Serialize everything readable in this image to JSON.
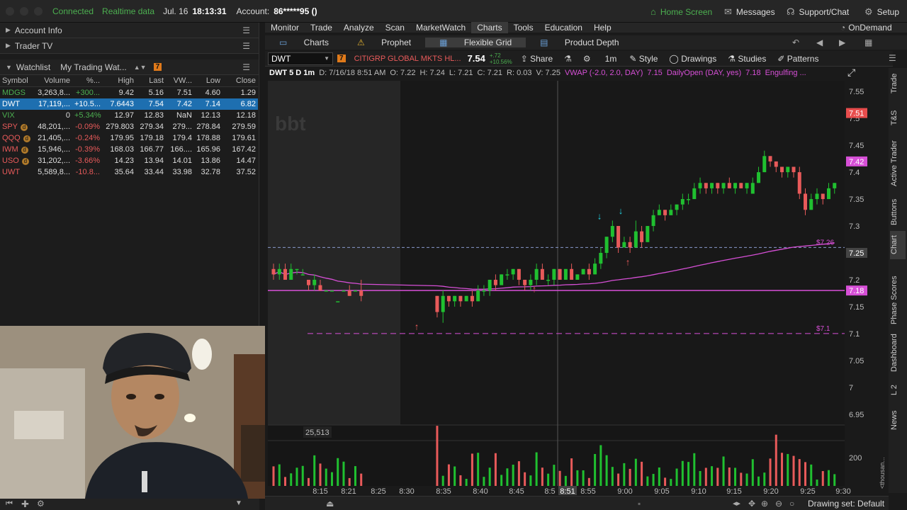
{
  "topbar": {
    "status": "Connected",
    "data_mode": "Realtime data",
    "date": "Jul. 16",
    "time": "18:13:31",
    "account_label": "Account:",
    "account_value": "86*****95 ()",
    "home_screen": "Home Screen",
    "messages": "Messages",
    "support": "Support/Chat",
    "setup": "Setup"
  },
  "left": {
    "account_info": "Account Info",
    "trader_tv": "Trader TV",
    "watchlist_label": "Watchlist",
    "watchlist_name": "My Trading Wat...",
    "watchlist_badge": "7",
    "columns": [
      "Symbol",
      "Volume",
      "%...",
      "High",
      "Last",
      "VW...",
      "Low",
      "Close"
    ],
    "rows": [
      {
        "symbol": "MDGS",
        "volume": "3,263,8...",
        "pct": "+300...",
        "high": "9.42",
        "last": "5.16",
        "vw": "7.51",
        "low": "4.60",
        "close": "1.29",
        "dir": "pos",
        "badge": ""
      },
      {
        "symbol": "DWT",
        "volume": "17,119,...",
        "pct": "+10.5...",
        "high": "7.6443",
        "last": "7.54",
        "vw": "7.42",
        "low": "7.14",
        "close": "6.82",
        "dir": "sel",
        "badge": ""
      },
      {
        "symbol": "VIX",
        "volume": "0",
        "pct": "+5.34%",
        "high": "12.97",
        "last": "12.83",
        "vw": "NaN",
        "low": "12.13",
        "close": "12.18",
        "dir": "pos",
        "badge": ""
      },
      {
        "symbol": "SPY",
        "volume": "48,201,...",
        "pct": "-0.09%",
        "high": "279.803",
        "last": "279.34",
        "vw": "279...",
        "low": "278.84",
        "close": "279.59",
        "dir": "neg",
        "badge": "d"
      },
      {
        "symbol": "QQQ",
        "volume": "21,405,...",
        "pct": "-0.24%",
        "high": "179.95",
        "last": "179.18",
        "vw": "179.4",
        "low": "178.88",
        "close": "179.61",
        "dir": "neg",
        "badge": "d"
      },
      {
        "symbol": "IWM",
        "volume": "15,946,...",
        "pct": "-0.39%",
        "high": "168.03",
        "last": "166.77",
        "vw": "166....",
        "low": "165.96",
        "close": "167.42",
        "dir": "neg",
        "badge": "d"
      },
      {
        "symbol": "USO",
        "volume": "31,202,...",
        "pct": "-3.66%",
        "high": "14.23",
        "last": "13.94",
        "vw": "14.01",
        "low": "13.86",
        "close": "14.47",
        "dir": "neg",
        "badge": "d"
      },
      {
        "symbol": "UWT",
        "volume": "5,589,8...",
        "pct": "-10.8...",
        "high": "35.64",
        "last": "33.44",
        "vw": "33.98",
        "low": "32.78",
        "close": "37.52",
        "dir": "neg",
        "badge": ""
      }
    ]
  },
  "menu": [
    "Monitor",
    "Trade",
    "Analyze",
    "Scan",
    "MarketWatch",
    "Charts",
    "Tools",
    "Education",
    "Help"
  ],
  "menu_active": "Charts",
  "ondemand": "OnDemand",
  "subtabs": [
    "Charts",
    "Prophet",
    "Flexible Grid",
    "Product Depth"
  ],
  "toolbar": {
    "symbol": "DWT",
    "badge": "7",
    "description": "CITIGRP GLOBAL MKTS HL...",
    "price": "7.54",
    "change_top": "+.72",
    "change_bottom": "+10.56%",
    "share": "Share",
    "interval": "1m",
    "style": "Style",
    "drawings": "Drawings",
    "studies": "Studies",
    "patterns": "Patterns"
  },
  "infobar": {
    "title": "DWT 5 D 1m",
    "d": "D: 7/16/18 8:51 AM",
    "o": "O: 7.22",
    "h": "H: 7.24",
    "l": "L: 7.21",
    "c": "C: 7.21",
    "r": "R: 0.03",
    "v": "V: 7.25",
    "vwap": "VWAP (-2.0, 2.0, DAY)",
    "vwap_val": "7.15",
    "daily": "DailyOpen (DAY, yes)",
    "daily_val": "7.18",
    "engulf": "Engulfing ..."
  },
  "chart_data": {
    "type": "candlestick",
    "price_axis_ticks": [
      "7.55",
      "7.5",
      "7.45",
      "7.4",
      "7.35",
      "7.3",
      "7.25",
      "7.2",
      "7.15",
      "7.1",
      "7.05",
      "7",
      "6.95"
    ],
    "ylim": [
      6.93,
      7.57
    ],
    "time_ticks": [
      "8:15",
      "8:21",
      "8:25",
      "8:30",
      "8:35",
      "8:40",
      "8:45",
      "8:5",
      "8:51",
      "8:55",
      "9:00",
      "9:05",
      "9:10",
      "9:15",
      "9:20",
      "9:25",
      "9:30"
    ],
    "price_labels": [
      {
        "value": 7.51,
        "text": "7.51",
        "color": "#e84d4d"
      },
      {
        "value": 7.42,
        "text": "7.42",
        "color": "#d64fd6"
      },
      {
        "value": 7.25,
        "text": "7.25",
        "color": "#444444"
      },
      {
        "value": 7.18,
        "text": "7.18",
        "color": "#d64fd6"
      }
    ],
    "line_labels": [
      {
        "value": 7.26,
        "text": "$7.26"
      },
      {
        "value": 7.1,
        "text": "$7.1"
      }
    ],
    "daily_open": 7.18,
    "dashed_support": 7.1,
    "dashed_level": 7.26,
    "volume_label": "25,513",
    "volume_axis": [
      "200"
    ],
    "volume_unit": "<thousan...",
    "candles": [
      [
        7.22,
        7.21,
        7.23,
        7.2
      ],
      [
        7.21,
        7.22,
        7.23,
        7.2
      ],
      [
        7.22,
        7.2,
        7.23,
        7.2
      ],
      [
        7.2,
        7.22,
        7.23,
        7.2
      ],
      [
        7.22,
        7.22,
        7.22,
        7.21
      ],
      [
        7.21,
        7.21,
        7.22,
        7.21
      ],
      [
        7.2,
        7.19,
        7.2,
        7.18
      ],
      [
        7.19,
        7.2,
        7.21,
        7.18
      ],
      [
        7.19,
        7.18,
        7.2,
        7.18
      ],
      [
        7.18,
        7.18,
        7.18,
        7.18
      ],
      [
        7.18,
        7.18,
        7.18,
        7.18
      ],
      [
        7.16,
        7.16,
        7.16,
        7.16
      ],
      [
        7.18,
        7.18,
        7.18,
        7.18
      ],
      [
        7.18,
        7.17,
        7.19,
        7.17
      ],
      [
        7.18,
        7.18,
        7.18,
        7.18
      ],
      [
        7.18,
        7.17,
        7.2,
        7.16
      ],
      [
        7.17,
        7.14,
        7.17,
        7.13
      ],
      [
        7.14,
        7.17,
        7.18,
        7.12
      ],
      [
        7.17,
        7.16,
        7.17,
        7.15
      ],
      [
        7.16,
        7.17,
        7.17,
        7.15
      ],
      [
        7.17,
        7.16,
        7.17,
        7.15
      ],
      [
        7.16,
        7.17,
        7.17,
        7.16
      ],
      [
        7.17,
        7.16,
        7.18,
        7.15
      ],
      [
        7.16,
        7.18,
        7.19,
        7.16
      ],
      [
        7.18,
        7.18,
        7.19,
        7.17
      ],
      [
        7.18,
        7.2,
        7.2,
        7.17
      ],
      [
        7.2,
        7.19,
        7.21,
        7.18
      ],
      [
        7.19,
        7.21,
        7.21,
        7.19
      ],
      [
        7.21,
        7.21,
        7.22,
        7.2
      ],
      [
        7.21,
        7.22,
        7.22,
        7.2
      ],
      [
        7.22,
        7.2,
        7.22,
        7.19
      ],
      [
        7.2,
        7.19,
        7.2,
        7.18
      ],
      [
        7.19,
        7.2,
        7.21,
        7.18
      ],
      [
        7.2,
        7.22,
        7.23,
        7.19
      ],
      [
        7.22,
        7.2,
        7.23,
        7.2
      ],
      [
        7.2,
        7.2,
        7.21,
        7.19
      ],
      [
        7.2,
        7.22,
        7.22,
        7.19
      ],
      [
        7.22,
        7.2,
        7.22,
        7.2
      ],
      [
        7.2,
        7.22,
        7.22,
        7.2
      ],
      [
        7.22,
        7.2,
        7.23,
        7.2
      ],
      [
        7.2,
        7.21,
        7.21,
        7.2
      ],
      [
        7.21,
        7.22,
        7.22,
        7.21
      ],
      [
        7.22,
        7.21,
        7.23,
        7.2
      ],
      [
        7.21,
        7.23,
        7.24,
        7.21
      ],
      [
        7.23,
        7.25,
        7.26,
        7.22
      ],
      [
        7.25,
        7.28,
        7.28,
        7.24
      ],
      [
        7.28,
        7.3,
        7.31,
        7.27
      ],
      [
        7.3,
        7.26,
        7.3,
        7.25
      ],
      [
        7.26,
        7.27,
        7.28,
        7.26
      ],
      [
        7.27,
        7.26,
        7.28,
        7.25
      ],
      [
        7.26,
        7.29,
        7.31,
        7.26
      ],
      [
        7.29,
        7.27,
        7.3,
        7.26
      ],
      [
        7.27,
        7.3,
        7.3,
        7.27
      ],
      [
        7.3,
        7.32,
        7.33,
        7.29
      ],
      [
        7.32,
        7.33,
        7.34,
        7.32
      ],
      [
        7.33,
        7.32,
        7.33,
        7.31
      ],
      [
        7.32,
        7.33,
        7.34,
        7.32
      ],
      [
        7.33,
        7.34,
        7.34,
        7.32
      ],
      [
        7.34,
        7.35,
        7.36,
        7.33
      ],
      [
        7.35,
        7.35,
        7.36,
        7.34
      ],
      [
        7.35,
        7.37,
        7.38,
        7.35
      ],
      [
        7.37,
        7.38,
        7.39,
        7.36
      ],
      [
        7.38,
        7.37,
        7.38,
        7.36
      ],
      [
        7.37,
        7.38,
        7.38,
        7.36
      ],
      [
        7.38,
        7.37,
        7.38,
        7.36
      ],
      [
        7.37,
        7.38,
        7.38,
        7.36
      ],
      [
        7.38,
        7.37,
        7.39,
        7.37
      ],
      [
        7.37,
        7.38,
        7.38,
        7.36
      ],
      [
        7.38,
        7.37,
        7.38,
        7.37
      ],
      [
        7.37,
        7.38,
        7.38,
        7.36
      ],
      [
        7.36,
        7.38,
        7.39,
        7.36
      ],
      [
        7.38,
        7.4,
        7.41,
        7.38
      ],
      [
        7.4,
        7.43,
        7.44,
        7.4
      ],
      [
        7.43,
        7.42,
        7.43,
        7.41
      ],
      [
        7.42,
        7.41,
        7.42,
        7.4
      ],
      [
        7.41,
        7.4,
        7.41,
        7.39
      ],
      [
        7.4,
        7.41,
        7.41,
        7.39
      ],
      [
        7.41,
        7.4,
        7.41,
        7.39
      ],
      [
        7.4,
        7.36,
        7.41,
        7.35
      ],
      [
        7.36,
        7.33,
        7.37,
        7.32
      ],
      [
        7.33,
        7.35,
        7.36,
        7.33
      ],
      [
        7.35,
        7.36,
        7.37,
        7.34
      ],
      [
        7.36,
        7.35,
        7.36,
        7.34
      ],
      [
        7.35,
        7.37,
        7.38,
        7.35
      ],
      [
        7.37,
        7.38,
        7.38,
        7.36
      ]
    ]
  },
  "side_tabs": [
    "Trade",
    "T&S",
    "Active Trader",
    "Buttons",
    "Chart",
    "Phase Scores",
    "Dashboard",
    "L 2",
    "News"
  ],
  "bottombar": {
    "drawing_set": "Drawing set: Default"
  },
  "watermark": "bbt"
}
